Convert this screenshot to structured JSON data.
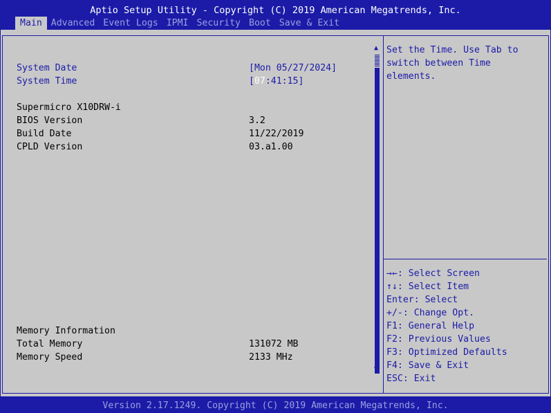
{
  "header": {
    "title": "Aptio Setup Utility - Copyright (C) 2019 American Megatrends, Inc.",
    "tabs": [
      "Main",
      "Advanced",
      "Event Logs",
      "IPMI",
      "Security",
      "Boot",
      "Save & Exit"
    ],
    "active_tab": "Main"
  },
  "main": {
    "system_date_label": "System Date",
    "system_date_value": "[Mon 05/27/2024]",
    "system_time_label": "System Time",
    "system_time_open": "[",
    "system_time_hour": "07",
    "system_time_rest": ":41:15]",
    "board_name": "Supermicro X10DRW-i",
    "bios_version_label": "BIOS Version",
    "bios_version_value": "3.2",
    "build_date_label": "Build Date",
    "build_date_value": "11/22/2019",
    "cpld_version_label": "CPLD Version",
    "cpld_version_value": "03.a1.00",
    "memory_info_label": "Memory Information",
    "total_memory_label": "Total Memory",
    "total_memory_value": "131072 MB",
    "memory_speed_label": "Memory Speed",
    "memory_speed_value": "2133 MHz"
  },
  "help": {
    "description": [
      "Set the Time. Use Tab to",
      "switch between Time",
      "elements."
    ],
    "keys": [
      "→←: Select Screen",
      "↑↓: Select Item",
      "Enter: Select",
      "+/-: Change Opt.",
      "F1: General Help",
      "F2: Previous Values",
      "F3: Optimized Defaults",
      "F4: Save & Exit",
      "ESC: Exit"
    ]
  },
  "footer": {
    "text": "Version 2.17.1249. Copyright (C) 2019 American Megatrends, Inc."
  },
  "colors": {
    "background_blue": "#1b1ba8",
    "panel_gray": "#c8c8c8",
    "title_white": "#ffffff",
    "inactive_tab": "#9aa0e0"
  }
}
